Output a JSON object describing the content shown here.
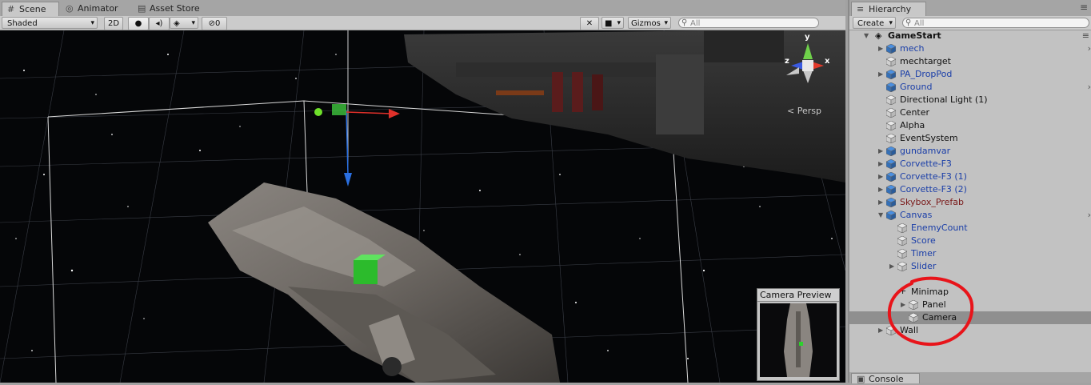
{
  "scene_tabs": {
    "scene": "Scene",
    "animator": "Animator",
    "asset_store": "Asset Store"
  },
  "scene_toolbar": {
    "shading_mode": "Shaded",
    "toggle_2d": "2D",
    "hidden_count": "0",
    "gizmos": "Gizmos",
    "search_placeholder": "All"
  },
  "viewport": {
    "projection_label": "Persp",
    "axis_x": "x",
    "axis_y": "y",
    "axis_z": "z"
  },
  "camera_preview": {
    "title": "Camera Preview"
  },
  "hierarchy": {
    "tab_label": "Hierarchy",
    "create_label": "Create",
    "search_placeholder": "All",
    "scene_name": "GameStart",
    "items": [
      {
        "label": "mech",
        "color": "blue",
        "arrow": true,
        "prefab": true
      },
      {
        "label": "mechtarget",
        "color": "black",
        "arrow": false,
        "prefab": false
      },
      {
        "label": "PA_DropPod",
        "color": "blue",
        "arrow": true,
        "prefab": true
      },
      {
        "label": "Ground",
        "color": "blue",
        "arrow": false,
        "prefab": true
      },
      {
        "label": "Directional Light (1)",
        "color": "black",
        "arrow": false,
        "prefab": false
      },
      {
        "label": "Center",
        "color": "black",
        "arrow": false,
        "prefab": false
      },
      {
        "label": "Alpha",
        "color": "black",
        "arrow": false,
        "prefab": false
      },
      {
        "label": "EventSystem",
        "color": "black",
        "arrow": false,
        "prefab": false
      },
      {
        "label": "gundamvar",
        "color": "blue",
        "arrow": true,
        "prefab": true
      },
      {
        "label": "Corvette-F3",
        "color": "blue",
        "arrow": true,
        "prefab": true
      },
      {
        "label": "Corvette-F3 (1)",
        "color": "blue",
        "arrow": true,
        "prefab": true
      },
      {
        "label": "Corvette-F3 (2)",
        "color": "blue",
        "arrow": true,
        "prefab": true
      },
      {
        "label": "Skybox_Prefab",
        "color": "red",
        "arrow": true,
        "prefab": true
      },
      {
        "label": "Canvas",
        "color": "blue",
        "arrow": "open",
        "prefab": true
      },
      {
        "label": "EnemyCount",
        "color": "blue",
        "arrow": false,
        "prefab": false,
        "indent": 1
      },
      {
        "label": "Score",
        "color": "blue",
        "arrow": false,
        "prefab": false,
        "indent": 1
      },
      {
        "label": "Timer",
        "color": "blue",
        "arrow": false,
        "prefab": false,
        "indent": 1
      },
      {
        "label": "Slider",
        "color": "blue",
        "arrow": true,
        "prefab": false,
        "indent": 1
      },
      {
        "label": "",
        "color": "black",
        "arrow": false,
        "prefab": false,
        "indent": 1,
        "hidden": true
      },
      {
        "label": "Minimap",
        "color": "black",
        "arrow": false,
        "prefab": false,
        "indent": 1,
        "drag": true
      },
      {
        "label": "Panel",
        "color": "black",
        "arrow": true,
        "prefab": false,
        "indent": 2
      },
      {
        "label": "Camera",
        "color": "black",
        "arrow": false,
        "prefab": false,
        "indent": 2,
        "selected": true
      },
      {
        "label": "Wall",
        "color": "black",
        "arrow": true,
        "prefab": false
      }
    ]
  },
  "console": {
    "tab_label": "Console"
  },
  "annotation": {
    "circle_color": "#e8141a"
  }
}
